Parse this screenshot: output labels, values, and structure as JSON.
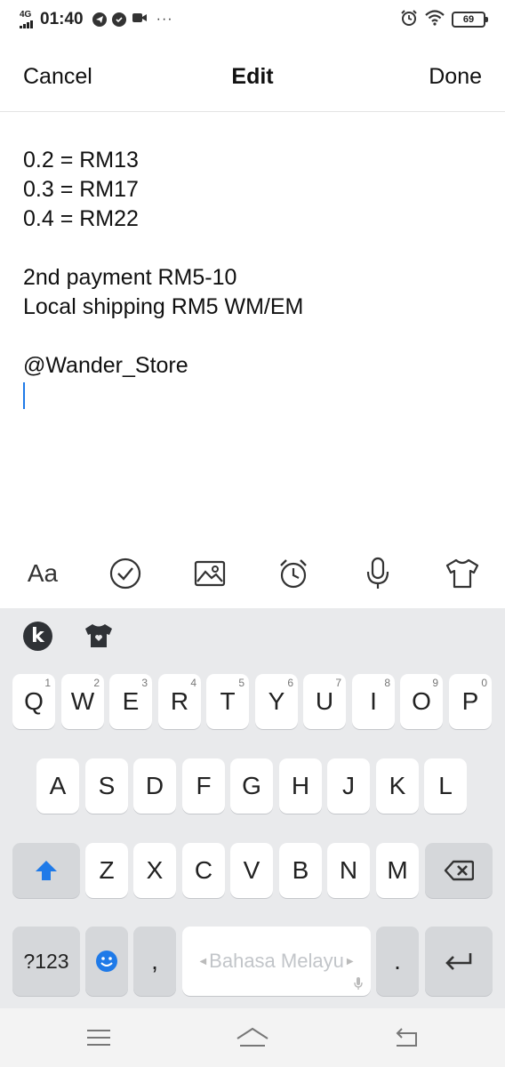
{
  "status_bar": {
    "network": "4G",
    "time": "01:40",
    "more": "···",
    "battery": "69",
    "icons": [
      "telegram-icon",
      "check-circle-icon",
      "video-icon",
      "alarm-icon",
      "wifi-icon",
      "battery-icon"
    ]
  },
  "header": {
    "cancel_label": "Cancel",
    "title": "Edit",
    "done_label": "Done"
  },
  "editor": {
    "lines": [
      "0.2 = RM13",
      "0.3 = RM17",
      "0.4 = RM22",
      "",
      "2nd payment RM5-10",
      "Local shipping RM5 WM/EM",
      "",
      "@Wander_Store"
    ]
  },
  "toolbar": {
    "text_format_label": "Aa",
    "icons": [
      "checklist-icon",
      "image-icon",
      "alarm-clock-icon",
      "microphone-icon",
      "shirt-icon"
    ]
  },
  "keyboard": {
    "row1": [
      {
        "label": "Q",
        "num": "1"
      },
      {
        "label": "W",
        "num": "2"
      },
      {
        "label": "E",
        "num": "3"
      },
      {
        "label": "R",
        "num": "4"
      },
      {
        "label": "T",
        "num": "5"
      },
      {
        "label": "Y",
        "num": "6"
      },
      {
        "label": "U",
        "num": "7"
      },
      {
        "label": "I",
        "num": "8"
      },
      {
        "label": "O",
        "num": "9"
      },
      {
        "label": "P",
        "num": "0"
      }
    ],
    "row2": [
      "A",
      "S",
      "D",
      "F",
      "G",
      "H",
      "J",
      "K",
      "L"
    ],
    "row3": [
      "Z",
      "X",
      "C",
      "V",
      "B",
      "N",
      "M"
    ],
    "symbols_label": "?123",
    "comma_label": ",",
    "space_label": "Bahasa Melayu",
    "period_label": ".",
    "accent_color": "#1f7ae8"
  }
}
